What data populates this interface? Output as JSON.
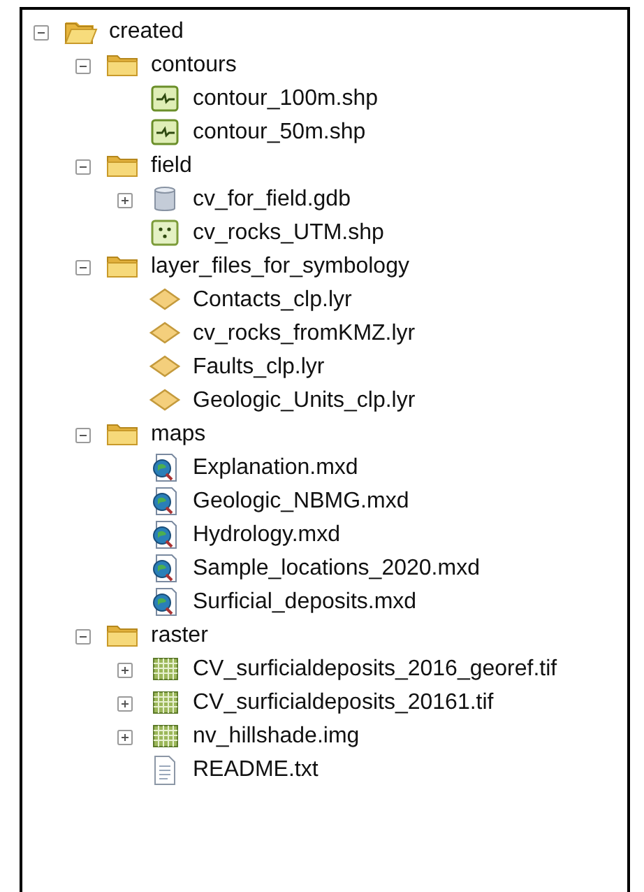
{
  "tree": [
    {
      "label": "created",
      "kind": "open-folder",
      "expanded": true,
      "children": [
        {
          "label": "contours",
          "kind": "folder",
          "expanded": true,
          "children": [
            {
              "label": "contour_100m.shp",
              "kind": "line-shapefile"
            },
            {
              "label": "contour_50m.shp",
              "kind": "line-shapefile"
            }
          ]
        },
        {
          "label": "field",
          "kind": "folder",
          "expanded": true,
          "children": [
            {
              "label": "cv_for_field.gdb",
              "kind": "geodatabase",
              "expanded": false
            },
            {
              "label": "cv_rocks_UTM.shp",
              "kind": "point-shapefile"
            }
          ]
        },
        {
          "label": "layer_files_for_symbology",
          "kind": "folder",
          "expanded": true,
          "children": [
            {
              "label": "Contacts_clp.lyr",
              "kind": "layer"
            },
            {
              "label": "cv_rocks_fromKMZ.lyr",
              "kind": "layer"
            },
            {
              "label": "Faults_clp.lyr",
              "kind": "layer"
            },
            {
              "label": "Geologic_Units_clp.lyr",
              "kind": "layer"
            }
          ]
        },
        {
          "label": "maps",
          "kind": "folder",
          "expanded": true,
          "children": [
            {
              "label": "Explanation.mxd",
              "kind": "map"
            },
            {
              "label": "Geologic_NBMG.mxd",
              "kind": "map"
            },
            {
              "label": "Hydrology.mxd",
              "kind": "map"
            },
            {
              "label": "Sample_locations_2020.mxd",
              "kind": "map"
            },
            {
              "label": "Surficial_deposits.mxd",
              "kind": "map"
            }
          ]
        },
        {
          "label": "raster",
          "kind": "folder",
          "expanded": true,
          "children": [
            {
              "label": "CV_surficialdeposits_2016_georef.tif",
              "kind": "raster",
              "expanded": false
            },
            {
              "label": "CV_surficialdeposits_20161.tif",
              "kind": "raster",
              "expanded": false
            },
            {
              "label": "nv_hillshade.img",
              "kind": "raster",
              "expanded": false
            },
            {
              "label": "README.txt",
              "kind": "text-file"
            }
          ]
        }
      ]
    }
  ]
}
